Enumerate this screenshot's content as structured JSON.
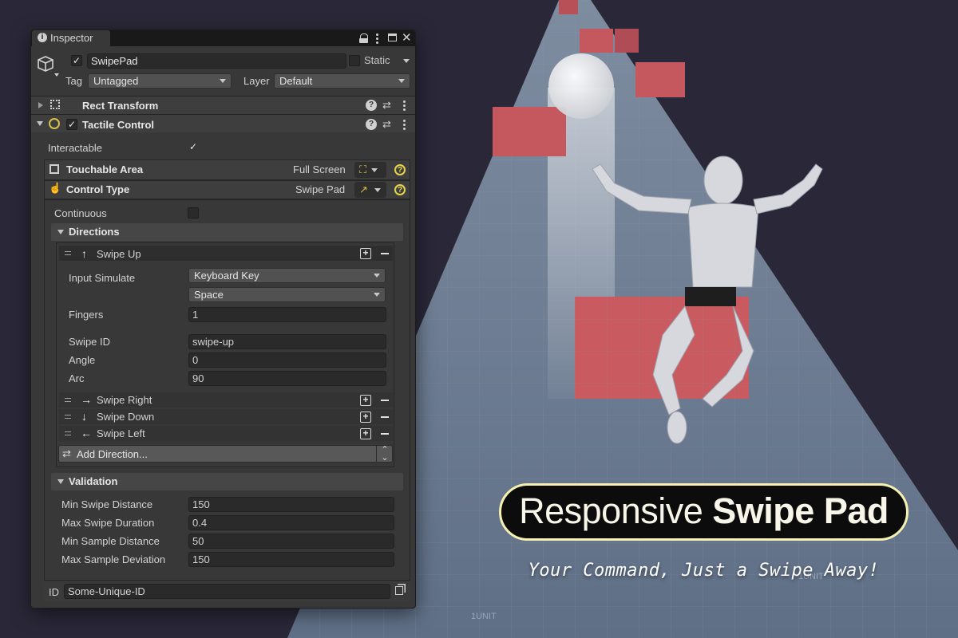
{
  "inspector": {
    "tab_title": "Inspector",
    "object_name": "SwipePad",
    "static_label": "Static",
    "tag_label": "Tag",
    "tag_value": "Untagged",
    "layer_label": "Layer",
    "layer_value": "Default",
    "components": {
      "rect_transform": "Rect Transform",
      "tactile_control": "Tactile Control"
    },
    "interactable_label": "Interactable",
    "interactable_checked": true,
    "touchable_area": {
      "label": "Touchable Area",
      "value": "Full Screen"
    },
    "control_type": {
      "label": "Control Type",
      "value": "Swipe Pad"
    },
    "continuous_label": "Continuous",
    "continuous_checked": false,
    "directions": {
      "header": "Directions",
      "expanded": {
        "label": "Swipe Up",
        "arrow": "↑",
        "input_simulate_label": "Input Simulate",
        "input_simulate_value": "Keyboard Key",
        "key_value": "Space",
        "fingers_label": "Fingers",
        "fingers_value": "1",
        "swipe_id_label": "Swipe ID",
        "swipe_id_value": "swipe-up",
        "angle_label": "Angle",
        "angle_value": "0",
        "arc_label": "Arc",
        "arc_value": "90"
      },
      "collapsed": [
        {
          "label": "Swipe Right",
          "arrow": "→"
        },
        {
          "label": "Swipe Down",
          "arrow": "↓"
        },
        {
          "label": "Swipe Left",
          "arrow": "←"
        }
      ],
      "add_label": "Add Direction..."
    },
    "validation": {
      "header": "Validation",
      "rows": [
        {
          "label": "Min Swipe Distance",
          "value": "150"
        },
        {
          "label": "Max Swipe Duration",
          "value": "0.4"
        },
        {
          "label": "Min Sample Distance",
          "value": "50"
        },
        {
          "label": "Max Sample Deviation",
          "value": "150"
        }
      ]
    },
    "id_label": "ID",
    "id_value": "Some-Unique-ID"
  },
  "banner": {
    "title_regular": "Responsive",
    "title_bold": "Swipe Pad",
    "tagline": "Your Command, Just a Swipe Away!"
  },
  "scene": {
    "floor_label": "1UNIT"
  },
  "colors": {
    "background": "#2a2838",
    "runway": "#6f7f94",
    "obstacle": "#c4585e",
    "banner_border": "#f5f0b0",
    "panel": "#383838"
  }
}
